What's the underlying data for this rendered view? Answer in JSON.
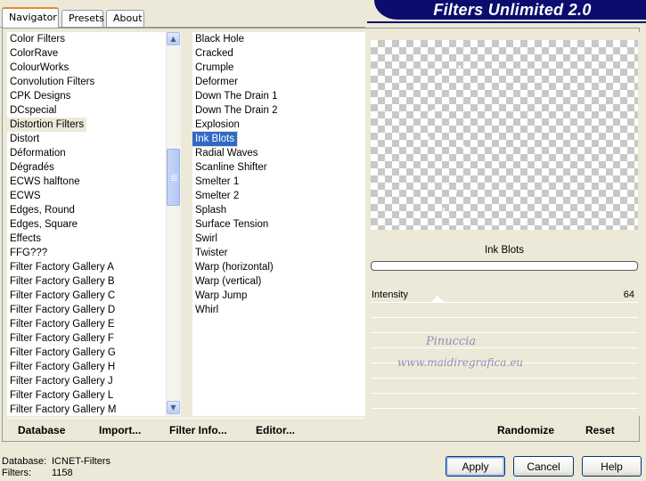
{
  "tabs": [
    "Navigator",
    "Presets",
    "About"
  ],
  "banner_title": "Filters Unlimited 2.0",
  "categories": [
    "Color Filters",
    "ColorRave",
    "ColourWorks",
    "Convolution Filters",
    "CPK Designs",
    "DCspecial",
    "Distortion Filters",
    "Distort",
    "Déformation",
    "Dégradés",
    "ECWS halftone",
    "ECWS",
    "Edges, Round",
    "Edges, Square",
    "Effects",
    "FFG???",
    "Filter Factory Gallery A",
    "Filter Factory Gallery B",
    "Filter Factory Gallery C",
    "Filter Factory Gallery D",
    "Filter Factory Gallery E",
    "Filter Factory Gallery F",
    "Filter Factory Gallery G",
    "Filter Factory Gallery H",
    "Filter Factory Gallery J",
    "Filter Factory Gallery L",
    "Filter Factory Gallery M"
  ],
  "selected_category": "Distortion Filters",
  "filters": [
    "Black Hole",
    "Cracked",
    "Crumple",
    "Deformer",
    "Down The Drain 1",
    "Down The Drain 2",
    "Explosion",
    "Ink Blots",
    "Radial Waves",
    "Scanline Shifter",
    "Smelter 1",
    "Smelter 2",
    "Splash",
    "Surface Tension",
    "Swirl",
    "Twister",
    "Warp (horizontal)",
    "Warp (vertical)",
    "Warp Jump",
    "Whirl"
  ],
  "selected_filter": "Ink Blots",
  "preview_title": "Ink Blots",
  "parameter": {
    "label": "Intensity",
    "value": "64",
    "fraction": 0.251
  },
  "watermark": {
    "line1": "Pinuccia",
    "line2": "www.maidiregrafica.eu"
  },
  "bottom_links": {
    "database": "Database",
    "import": "Import...",
    "filter_info": "Filter Info...",
    "editor": "Editor...",
    "randomize": "Randomize",
    "reset": "Reset"
  },
  "status": {
    "database_label": "Database:",
    "database_value": "ICNET-Filters",
    "filters_label": "Filters:",
    "filters_value": "1158"
  },
  "buttons": {
    "apply": "Apply",
    "cancel": "Cancel",
    "help": "Help"
  },
  "icons": {
    "scroll_up": "chevron-up-icon",
    "scroll_down": "chevron-down-icon"
  }
}
